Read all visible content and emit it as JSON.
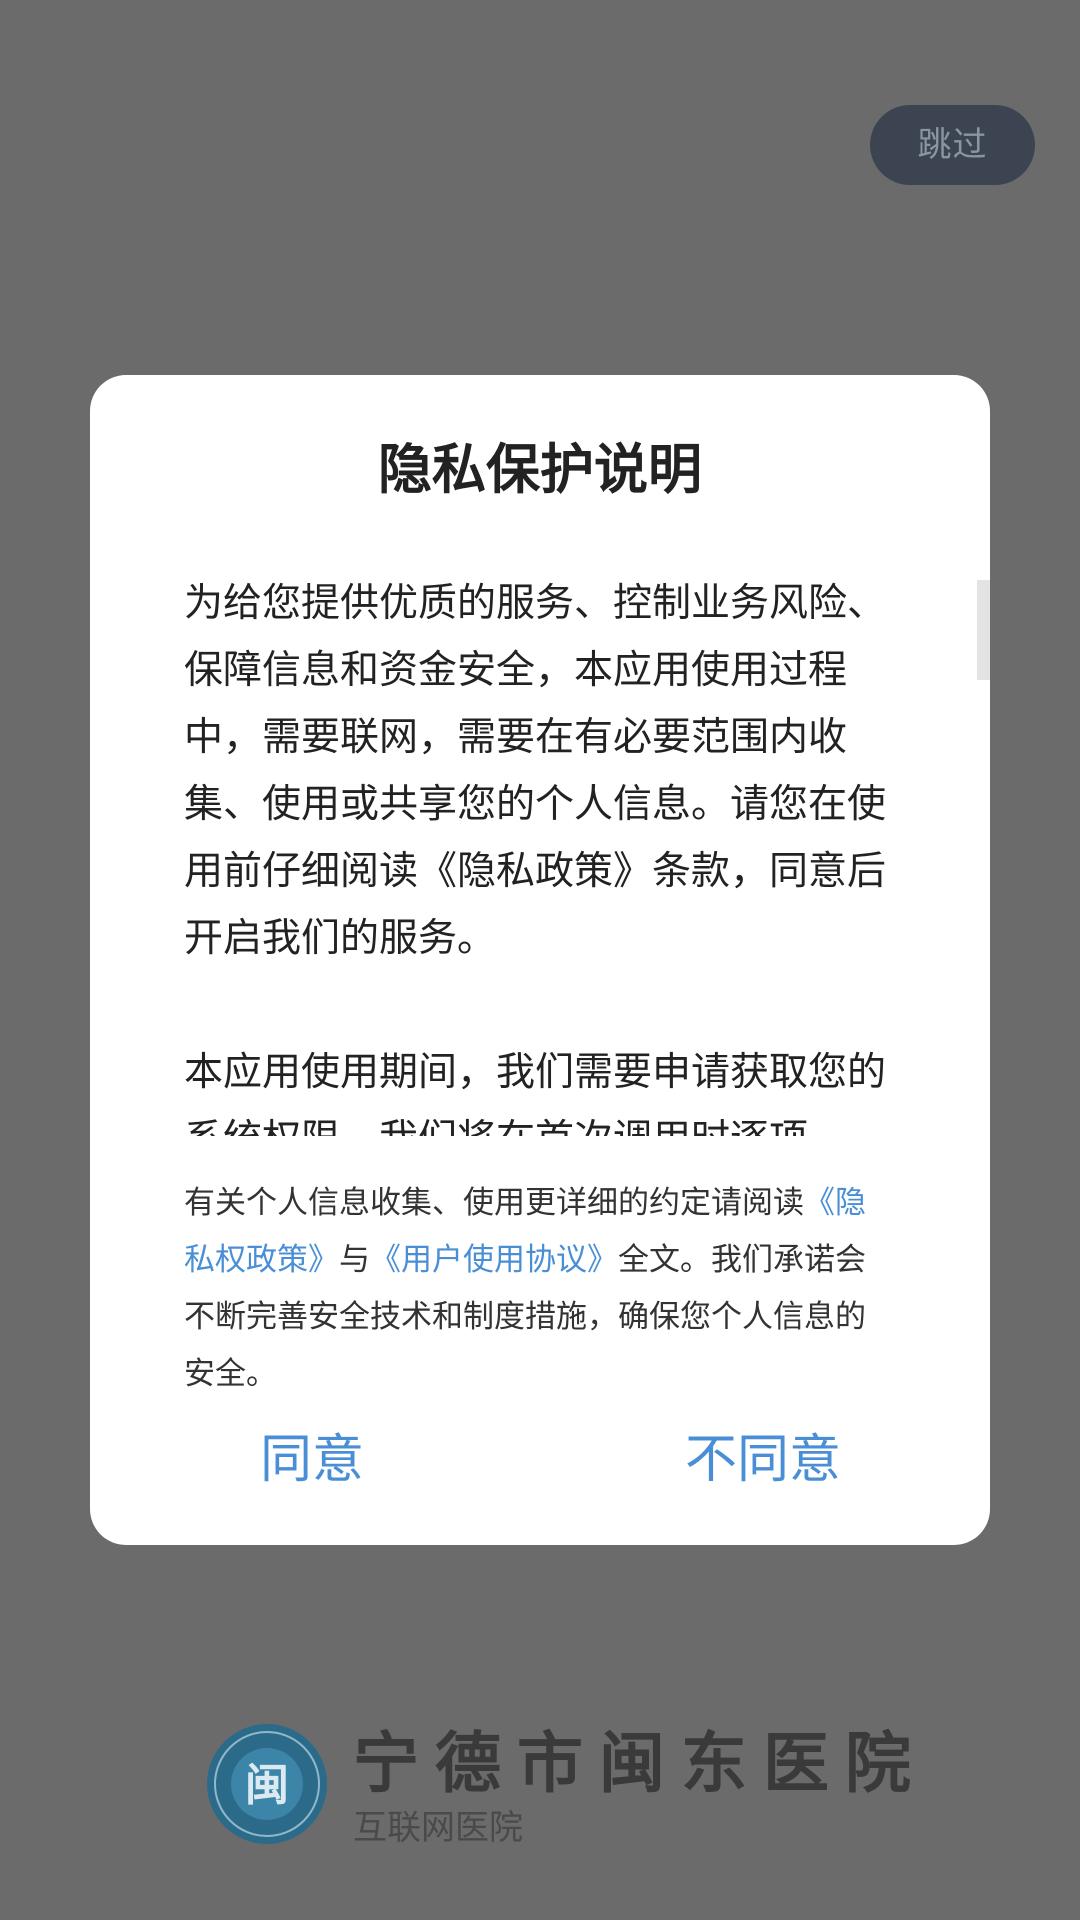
{
  "splash": {
    "skip_label": "跳过",
    "brand_name": "宁德市闽东医院",
    "brand_sub": "互联网医院",
    "logo_char": "闽"
  },
  "dialog": {
    "title": "隐私保护说明",
    "paragraphs": [
      "为给您提供优质的服务、控制业务风险、保障信息和资金安全，本应用使用过程中，需要联网，需要在有必要范围内收集、使用或共享您的个人信息。请您在使用前仔细阅读《隐私政策》条款，同意后开启我们的服务。",
      "本应用使用期间，我们需要申请获取您的系统权限，我们将在首次调用时逐项"
    ],
    "notice": {
      "prefix": "有关个人信息收集、使用更详细的约定请阅读",
      "privacy_link": "《隐私权政策》",
      "conjunction": "与",
      "agreement_link": "《用户使用协议》",
      "suffix": "全文。我们承诺会不断完善安全技术和制度措施，确保您个人信息的安全。"
    },
    "agree_label": "同意",
    "disagree_label": "不同意"
  },
  "colors": {
    "overlay": "#6b6b6b",
    "accent": "#4a8fd6",
    "skip_bg": "#3b4450"
  }
}
